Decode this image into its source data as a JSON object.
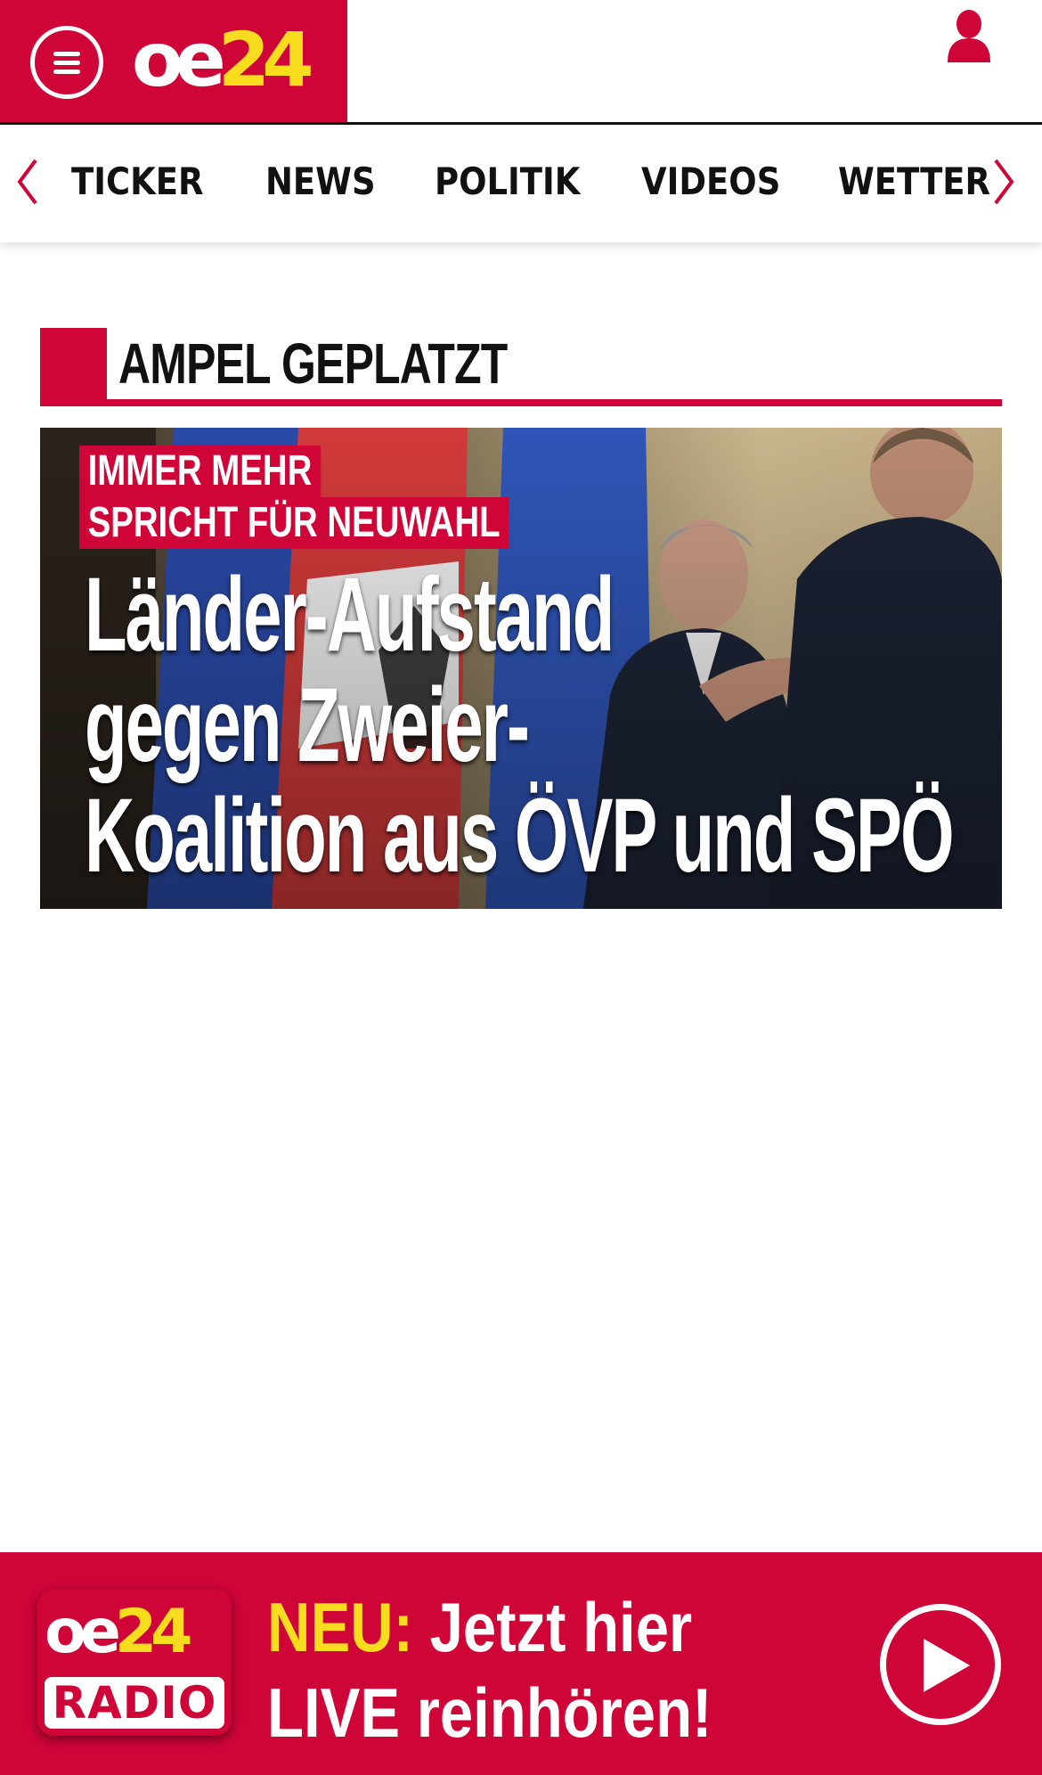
{
  "header": {
    "logo": {
      "oe": "oe",
      "num": "24"
    },
    "menu_icon": "hamburger-menu-icon",
    "user_icon": "user-account-icon"
  },
  "nav": {
    "prev_icon": "chevron-left-icon",
    "next_icon": "chevron-right-icon",
    "items": [
      "TICKER",
      "NEWS",
      "POLITIK",
      "VIDEOS",
      "WETTER"
    ]
  },
  "section": {
    "title": "AMPEL GEPLATZT"
  },
  "hero": {
    "kicker_line1": "IMMER MEHR",
    "kicker_line2": "SPRICHT FÜR NEUWAHL",
    "headline_line1": "Länder-Aufstand",
    "headline_line2": "gegen Zweier-",
    "headline_line3": "Koalition aus ÖVP und SPÖ"
  },
  "radio": {
    "logo_top_oe": "oe",
    "logo_top_num": "24",
    "logo_bottom": "RADIO",
    "neu": "NEU:",
    "line1_rest": " Jetzt hier",
    "line2": "LIVE reinhören!",
    "play_icon": "play-icon"
  },
  "colors": {
    "brand_red": "#cf0538",
    "brand_yellow": "#f8dc1e",
    "text_dark": "#111111"
  }
}
